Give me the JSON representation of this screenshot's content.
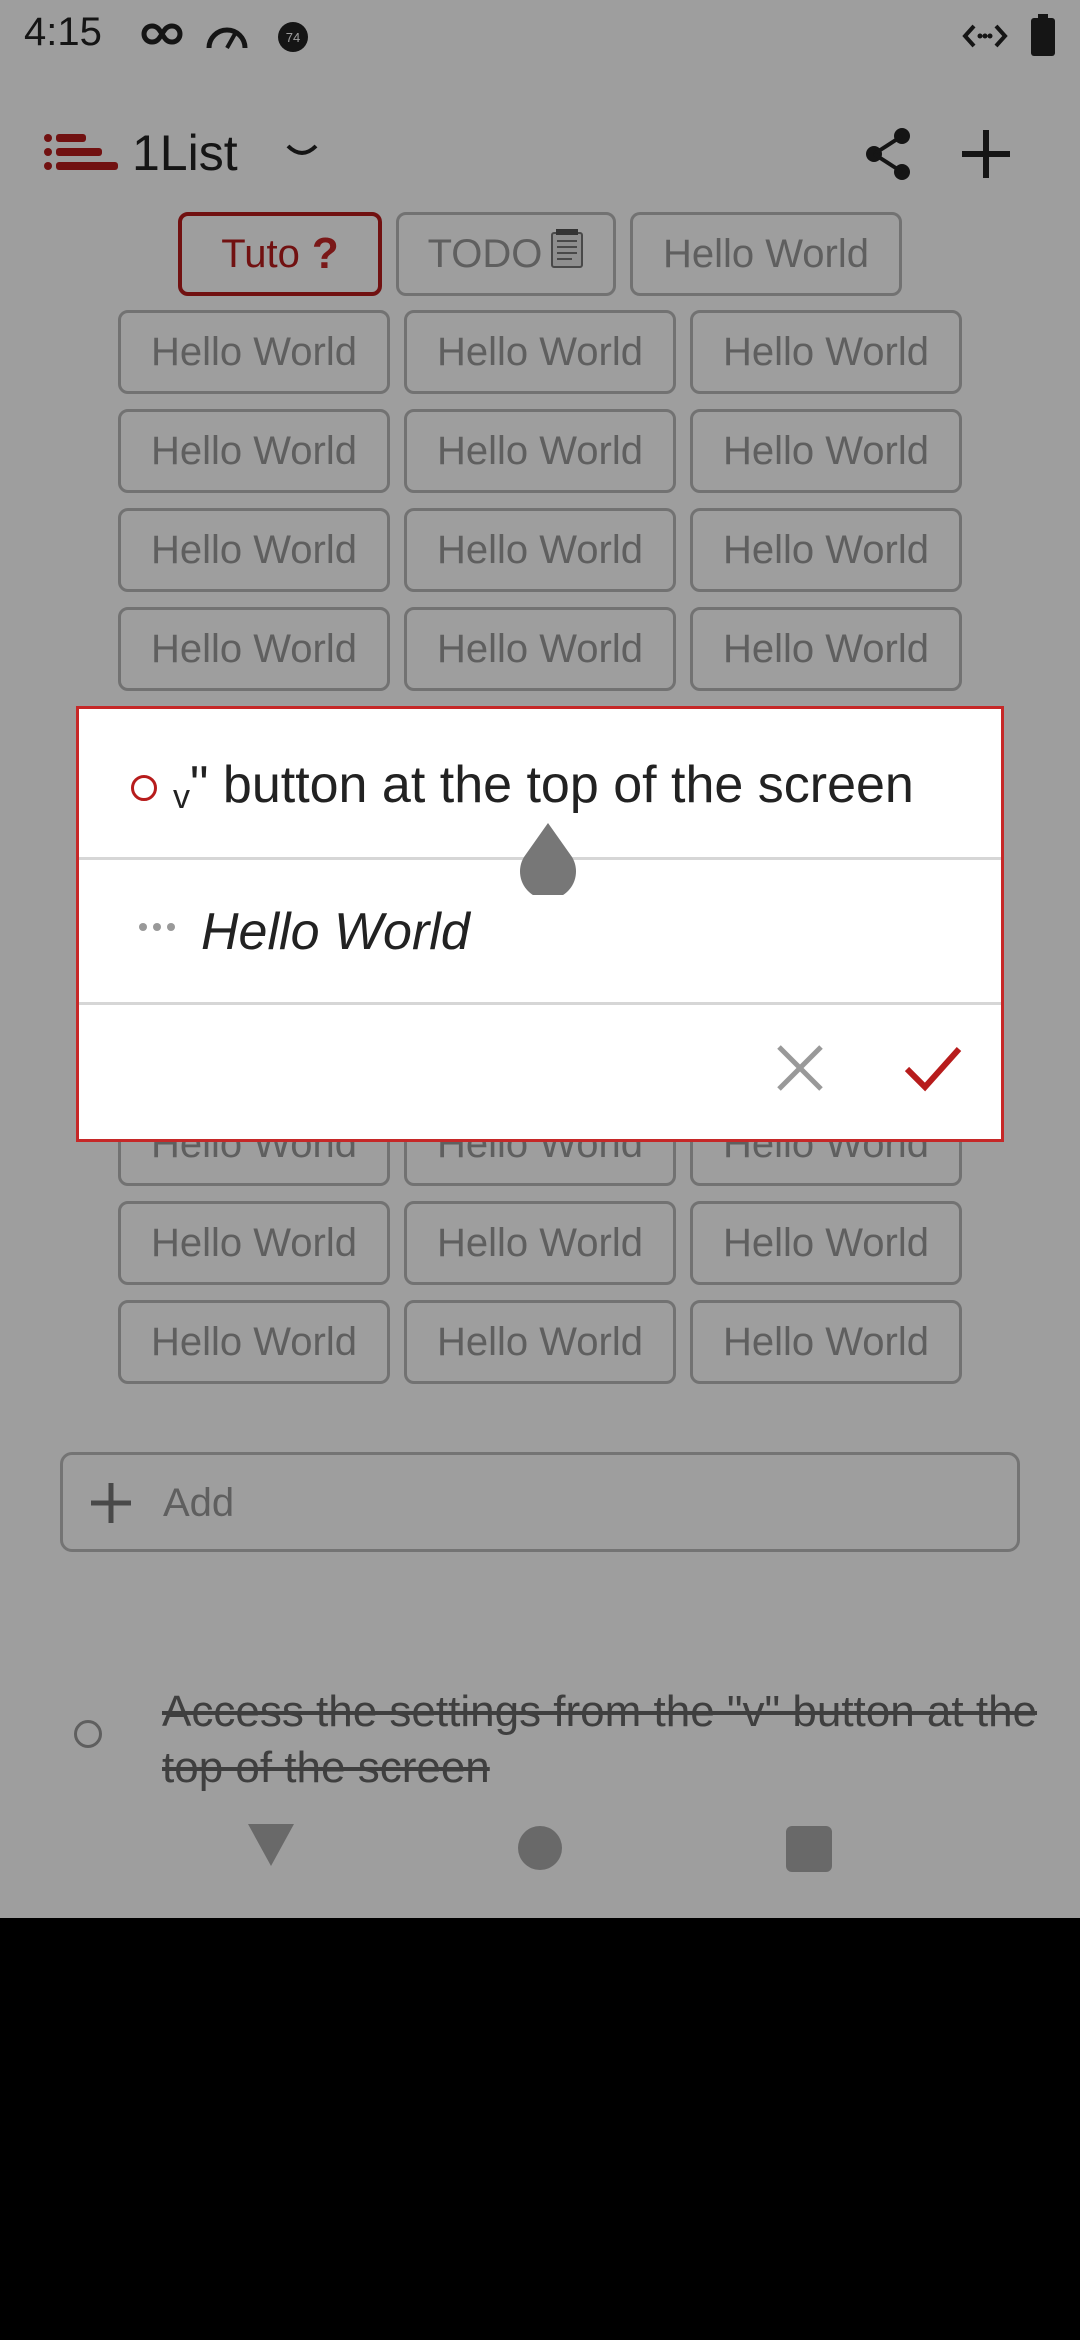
{
  "status_bar": {
    "time": "4:15",
    "badge": "74",
    "icons": [
      "infinity-icon",
      "speedometer-icon",
      "badge-icon",
      "code-icon",
      "battery-icon"
    ]
  },
  "app_bar": {
    "title": "1List",
    "icons": [
      "list-logo-icon",
      "chevron-down-icon",
      "share-icon",
      "plus-icon"
    ]
  },
  "tabs": {
    "tuto_label": "Tuto",
    "todo_label": "TODO",
    "hello_label": "Hello World"
  },
  "grid": {
    "rows": [
      [
        "Hello World",
        "Hello World",
        "Hello World"
      ],
      [
        "Hello World",
        "Hello World",
        "Hello World"
      ],
      [
        "Hello World",
        "Hello World",
        "Hello World"
      ],
      [
        "Hello World",
        "Hello World",
        "Hello World"
      ],
      [
        "Hello World",
        "Hello World",
        "Hello World"
      ],
      [
        "Hello World",
        "Hello World",
        "Hello World"
      ],
      [
        "Hello World",
        "Hello World",
        "Hello World"
      ]
    ]
  },
  "add_bar": {
    "label": "Add"
  },
  "done_item": {
    "text": "Access the settings from the \"v\" button at the top of the screen"
  },
  "dialog": {
    "edit_text_mark": "v",
    "edit_text": "\" button at the top of the screen",
    "list_name": "Hello World"
  },
  "colors": {
    "accent": "#b71c1c",
    "chip_border": "#b8b8b8",
    "chip_text": "#999999",
    "scrim": "rgba(0,0,0,0.38)"
  }
}
